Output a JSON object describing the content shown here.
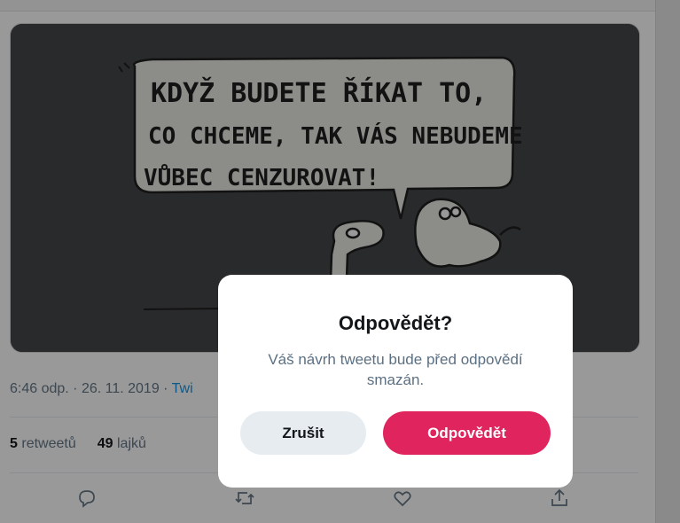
{
  "tweet": {
    "image": {
      "alt_icon": "cartoon-image",
      "speech_bubble_lines": [
        "KDYŽ BUDETE ŘÍKAT TO,",
        "CO CHCEME, TAK VÁS NEBUDEME",
        "VŮBEC CENZUROVAT!"
      ]
    },
    "timestamp": "6:46 odp. · 26. 11. 2019 · ",
    "source_partial": "Twi",
    "retweets_count": "5",
    "retweets_label": "retweetů",
    "likes_count": "49",
    "likes_label": "lajků",
    "actions": [
      "reply-icon",
      "retweet-icon",
      "like-icon",
      "share-icon"
    ]
  },
  "dialog": {
    "title": "Odpovědět?",
    "message": "Váš návrh tweetu bude před odpovědí smazán.",
    "cancel_label": "Zrušit",
    "confirm_label": "Odpovědět"
  },
  "colors": {
    "accent": "#e0245e",
    "cancel_bg": "#e6ecf0",
    "link": "#1b95e0",
    "muted_text": "#657786"
  }
}
